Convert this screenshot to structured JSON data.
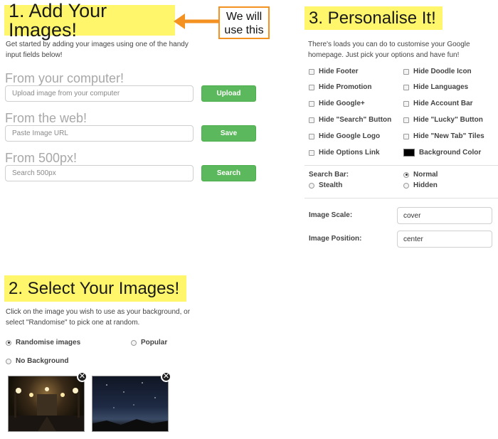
{
  "section1": {
    "heading": "1. Add Your Images!",
    "callout": "We will use this",
    "intro": "Get started by adding your images using one of the handy input fields below!",
    "sources": [
      {
        "label": "From your computer!",
        "placeholder": "Upload image from your computer",
        "button": "Upload"
      },
      {
        "label": "From the web!",
        "placeholder": "Paste Image URL",
        "button": "Save"
      },
      {
        "label": "From 500px!",
        "placeholder": "Search 500px",
        "button": "Search"
      }
    ]
  },
  "section2": {
    "heading": "2. Select Your Images!",
    "intro": "Click on the image you wish to use as your background, or select \"Randomise\" to pick one at random.",
    "options": [
      "Randomise images",
      "Popular",
      "No Background"
    ]
  },
  "section3": {
    "heading": "3. Personalise It!",
    "intro": "There's loads you can do to customise your Google homepage. Just pick your options and have fun!",
    "checkboxes_left": [
      "Hide Footer",
      "Hide Promotion",
      "Hide Google+",
      "Hide \"Search\" Button",
      "Hide Google Logo",
      "Hide Options Link"
    ],
    "checkboxes_right": [
      "Hide Doodle Icon",
      "Hide Languages",
      "Hide Account Bar",
      "Hide \"Lucky\" Button",
      "Hide \"New Tab\" Tiles"
    ],
    "background_color_label": "Background Color",
    "background_color": "#000000",
    "search_bar_label": "Search Bar:",
    "search_bar_options": [
      "Normal",
      "Stealth",
      "Hidden"
    ],
    "image_scale_label": "Image Scale:",
    "image_scale_value": "cover",
    "image_position_label": "Image Position:",
    "image_position_value": "center"
  },
  "colors": {
    "highlight": "#fff66b",
    "accent": "#f39220",
    "button": "#5cb85c"
  },
  "icons": {
    "remove": "close-icon",
    "arrow": "arrow-left-icon"
  }
}
